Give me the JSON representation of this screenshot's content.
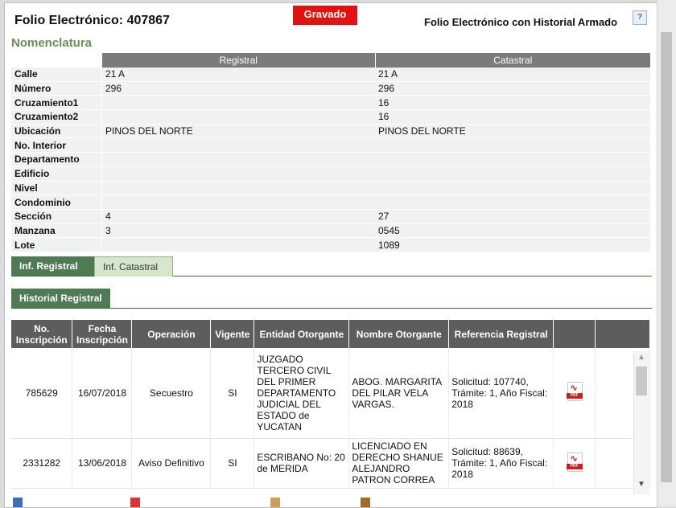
{
  "header": {
    "folio_label": "Folio Electrónico: 407867",
    "status_badge": "Gravado",
    "history_label": "Folio Electrónico con Historial Armado",
    "help_glyph": "?"
  },
  "nomenclatura": {
    "title": "Nomenclatura",
    "columns": [
      "Registral",
      "Catastral"
    ],
    "rows": [
      {
        "label": "Calle",
        "registral": "21 A",
        "catastral": "21 A"
      },
      {
        "label": "Número",
        "registral": "296",
        "catastral": "296"
      },
      {
        "label": "Cruzamiento1",
        "registral": "",
        "catastral": "16"
      },
      {
        "label": "Cruzamiento2",
        "registral": "",
        "catastral": "16"
      },
      {
        "label": "Ubicación",
        "registral": "PINOS DEL NORTE",
        "catastral": "PINOS DEL NORTE"
      },
      {
        "label": "No. Interior",
        "registral": "",
        "catastral": ""
      },
      {
        "label": "Departamento",
        "registral": "",
        "catastral": ""
      },
      {
        "label": "Edificio",
        "registral": "",
        "catastral": ""
      },
      {
        "label": "Nivel",
        "registral": "",
        "catastral": ""
      },
      {
        "label": "Condominio",
        "registral": "",
        "catastral": ""
      },
      {
        "label": "Sección",
        "registral": "4",
        "catastral": "27"
      },
      {
        "label": "Manzana",
        "registral": "3",
        "catastral": "0545"
      },
      {
        "label": "Lote",
        "registral": "",
        "catastral": "1089"
      }
    ]
  },
  "tabs": {
    "inf_registral": "Inf. Registral",
    "inf_catastral": "Inf. Catastral",
    "historial_registral": "Historial Registral"
  },
  "historial": {
    "headers": [
      "No. Inscripción",
      "Fecha Inscripción",
      "Operación",
      "Vigente",
      "Entidad Otorgante",
      "Nombre Otorgante",
      "Referencia Registral"
    ],
    "rows": [
      {
        "no": "785629",
        "fecha": "16/07/2018",
        "operacion": "Secuestro",
        "vigente": "SI",
        "entidad": "JUZGADO TERCERO CIVIL DEL PRIMER DEPARTAMENTO JUDICIAL DEL ESTADO de YUCATAN",
        "nombre": "ABOG. MARGARITA DEL PILAR VELA VARGAS.",
        "referencia": "Solicitud: 107740, Trámite: 1, Año Fiscal: 2018"
      },
      {
        "no": "2331282",
        "fecha": "13/06/2018",
        "operacion": "Aviso Definitivo",
        "vigente": "SI",
        "entidad": "ESCRIBANO No: 20 de MERIDA",
        "nombre": "LICENCIADO EN DERECHO SHANUE ALEJANDRO PATRON CORREA",
        "referencia": "Solicitud: 88639, Trámite: 1, Año Fiscal: 2018"
      }
    ]
  },
  "pdf_icon_label": "PDF",
  "colors": {
    "badge": "#e4120f",
    "accent": "#4f7b53",
    "section_title": "#6c8e54"
  }
}
